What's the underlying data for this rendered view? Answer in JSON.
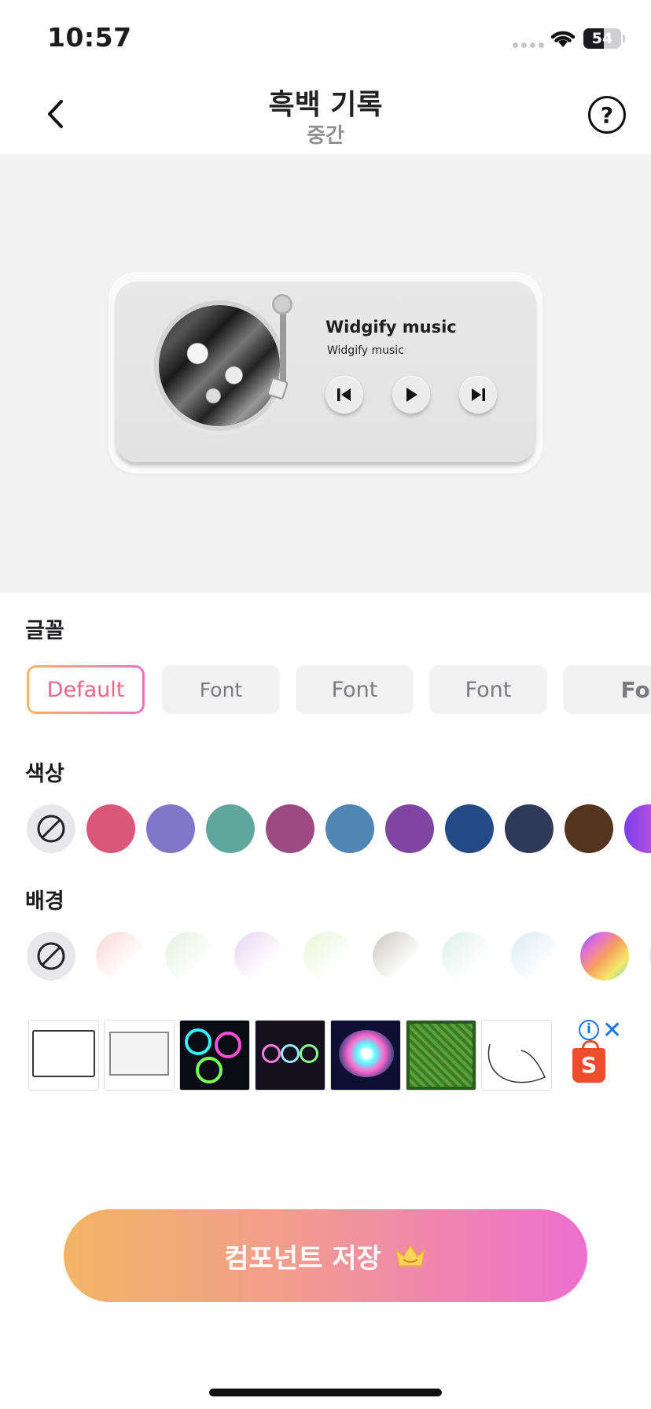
{
  "status_bar": {
    "time": "10:57",
    "battery": "54",
    "battery_level": 0.54
  },
  "nav": {
    "title": "흑백 기록",
    "subtitle": "중간",
    "back_icon": "chevron-left-icon",
    "help_icon": "question-circle-icon",
    "help_glyph": "?"
  },
  "widget": {
    "song_title": "Widgify music",
    "artist": "Widgify music",
    "controls": [
      "previous-icon",
      "play-icon",
      "next-icon"
    ]
  },
  "font_section": {
    "label": "글꼴",
    "options": [
      {
        "label": "Default",
        "selected": true
      },
      {
        "label": "Font",
        "selected": false
      },
      {
        "label": "Font",
        "selected": false
      },
      {
        "label": "Font",
        "selected": false
      },
      {
        "label": "Font",
        "selected": false
      }
    ]
  },
  "color_section": {
    "label": "색상",
    "swatches": [
      "none",
      "#d95677",
      "#8276c9",
      "#5fa79c",
      "#9b4a82",
      "#5085b4",
      "#7f45a0",
      "#234a85",
      "#2f3a5b",
      "#553321",
      "#a855e0"
    ]
  },
  "background_section": {
    "label": "배경",
    "swatches": [
      "none",
      "#f9d7d2",
      "#e3efdc",
      "#e7d2f0",
      "#eaf4d4",
      "#c9c8bf",
      "#d9f0e8",
      "#d8eaf3",
      "#d16fd8",
      "#d6d6f5"
    ]
  },
  "ad": {
    "info_glyph": "i",
    "close_glyph": "✕",
    "brand_glyph": "S"
  },
  "save_button": {
    "label": "컴포넌트 저장",
    "icon": "crown-icon"
  }
}
